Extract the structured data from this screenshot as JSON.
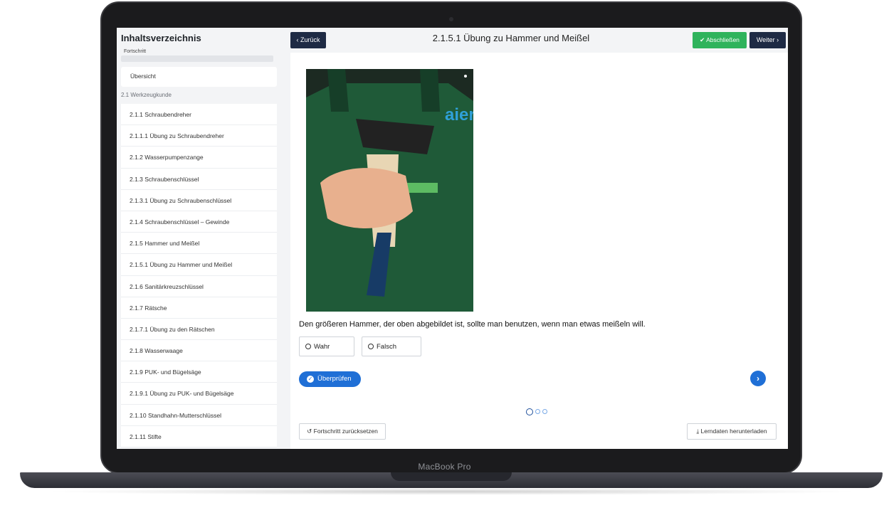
{
  "device": {
    "brand": "MacBook Pro"
  },
  "sidebar": {
    "title": "Inhaltsverzeichnis",
    "progress_label": "Fortschritt",
    "overview": "Übersicht",
    "section": "2.1 Werkzeugkunde",
    "items": [
      "2.1.1 Schraubendreher",
      "2.1.1.1 Übung zu Schraubendreher",
      "2.1.2 Wasserpumpenzange",
      "2.1.3 Schraubenschlüssel",
      "2.1.3.1 Übung zu Schraubenschlüssel",
      "2.1.4 Schraubenschlüssel – Gewinde",
      "2.1.5 Hammer und Meißel",
      "2.1.5.1 Übung zu Hammer und Meißel",
      "2.1.6 Sanitärkreuzschlüssel",
      "2.1.7 Rätsche",
      "2.1.7.1 Übung zu den Rätschen",
      "2.1.8 Wasserwaage",
      "2.1.9 PUK- und Bügelsäge",
      "2.1.9.1 Übung zu PUK- und Bügelsäge",
      "2.1.10 Standhahn-Mutterschlüssel",
      "2.1.11 Stifte"
    ]
  },
  "topbar": {
    "back_label": "Zurück",
    "title": "2.1.5.1 Übung zu Hammer und Meißel",
    "finish_label": "Abschließen",
    "next_label": "Weiter"
  },
  "exercise": {
    "question": "Den größeren Hammer, der oben abgebildet ist, sollte man benutzen, wenn man etwas meißeln will.",
    "options": [
      "Wahr",
      "Falsch"
    ],
    "check_label": "Überprüfen",
    "page_count": 3,
    "current_page": 1
  },
  "footer": {
    "reset_label": "Fortschritt zurücksetzen",
    "download_label": "Lerndaten herunterladen"
  },
  "colors": {
    "primary": "#1f6fd6",
    "navy": "#1e2a44",
    "success": "#2fb35c"
  }
}
